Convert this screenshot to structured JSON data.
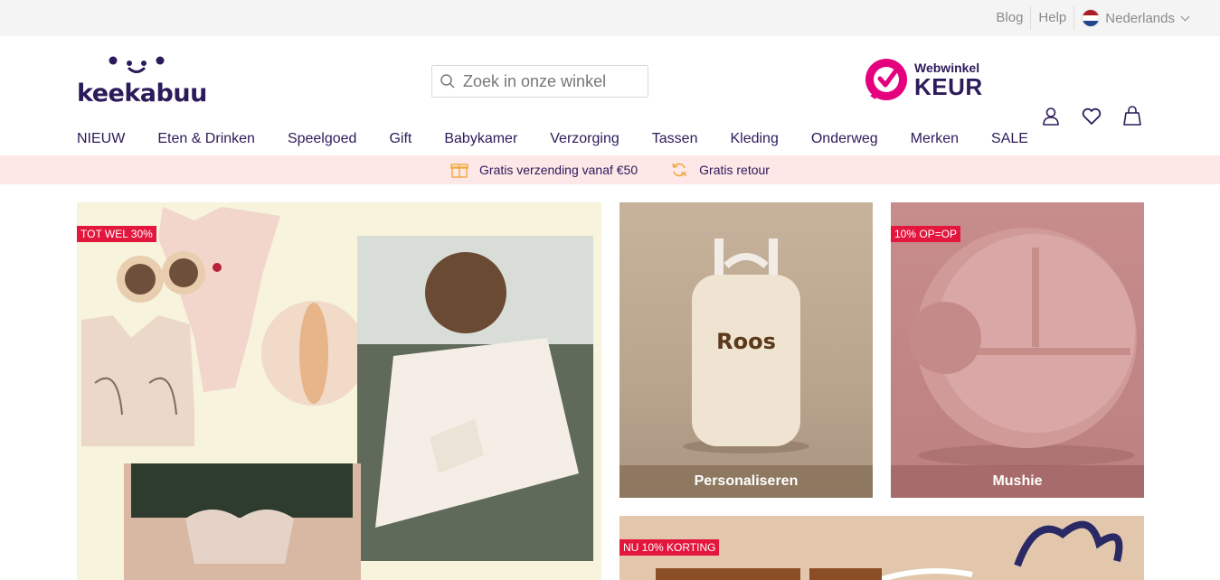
{
  "topbar": {
    "blog": "Blog",
    "help": "Help",
    "language": "Nederlands",
    "flag_colors": [
      "#ae1c28",
      "#ffffff",
      "#21468b"
    ]
  },
  "header": {
    "logo_text": "keekabuu",
    "search_placeholder": "Zoek in onze winkel",
    "keur_line1": "Webwinkel",
    "keur_line2": "KEUR",
    "keur_color": "#e5007e",
    "icons": [
      "user-icon",
      "heart-icon",
      "bag-icon"
    ]
  },
  "nav": {
    "items": [
      "NIEUW",
      "Eten & Drinken",
      "Speelgoed",
      "Gift",
      "Babykamer",
      "Verzorging",
      "Tassen",
      "Kleding",
      "Onderweg",
      "Merken",
      "SALE"
    ]
  },
  "promo": {
    "shipping": "Gratis verzending vanaf €50",
    "returns": "Gratis retour",
    "background": "#fde7e7",
    "icon_color": "#f2a93b"
  },
  "tiles": {
    "hero": {
      "badge": "TOT WEL 30%"
    },
    "bag": {
      "text": "Roos",
      "caption": "Personaliseren"
    },
    "mushie": {
      "badge": "10% OP=OP",
      "caption": "Mushie"
    },
    "school": {
      "badge": "NU 10% KORTING"
    }
  },
  "colors": {
    "brand": "#2b1b5a",
    "badge": "#e3173e"
  }
}
